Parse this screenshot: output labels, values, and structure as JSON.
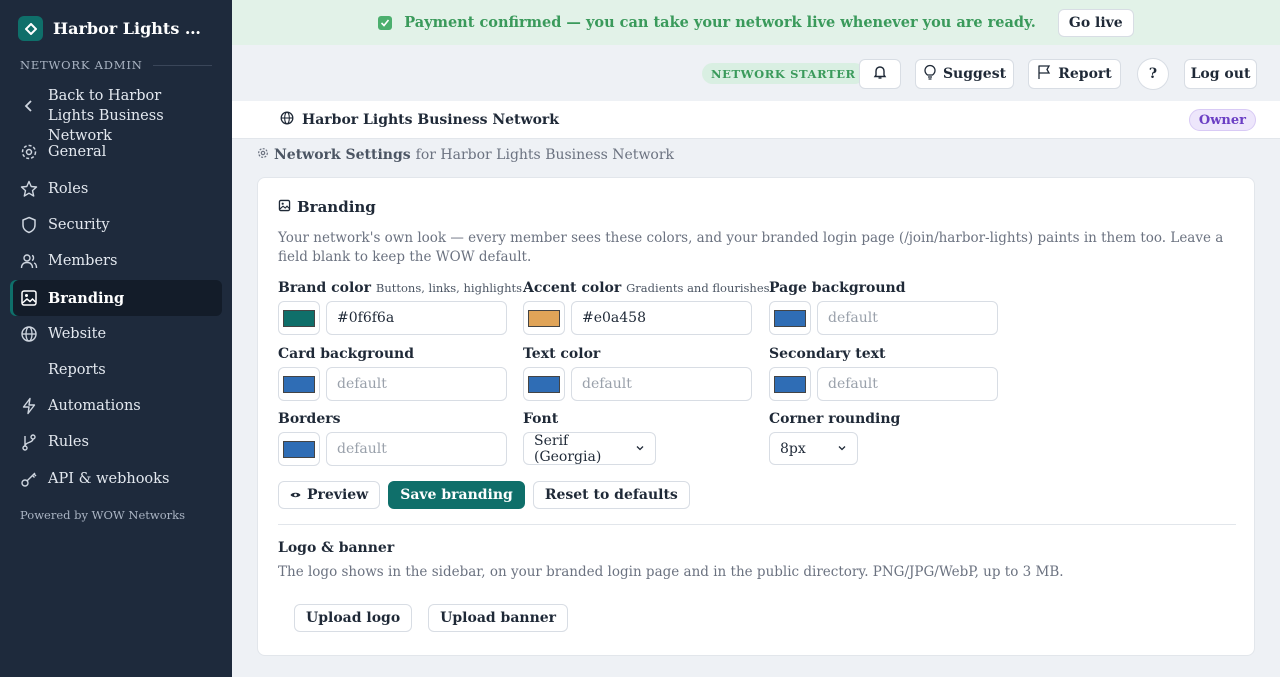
{
  "app": {
    "network_name": "Harbor Lights Business Network"
  },
  "sidebar": {
    "section_label": "NETWORK ADMIN",
    "back_label": "Back to Harbor Lights Business Network",
    "items": [
      {
        "label": "General",
        "icon": "gear-icon"
      },
      {
        "label": "Roles",
        "icon": "star-icon"
      },
      {
        "label": "Security",
        "icon": "shield-icon"
      },
      {
        "label": "Members",
        "icon": "users-icon"
      },
      {
        "label": "Branding",
        "icon": "image-icon",
        "active": true
      },
      {
        "label": "Website",
        "icon": "globe-icon"
      },
      {
        "label": "Reports",
        "icon": ""
      },
      {
        "label": "Automations",
        "icon": "bolt-icon"
      },
      {
        "label": "Rules",
        "icon": "branch-icon"
      },
      {
        "label": "API & webhooks",
        "icon": "key-icon"
      }
    ],
    "powered_by": "Powered by WOW Networks"
  },
  "banner": {
    "message": "Payment confirmed — you can take your network live whenever you are ready.",
    "go_live": "Go live"
  },
  "header": {
    "plan_badge": "NETWORK STARTER",
    "suggest": "Suggest",
    "report": "Report",
    "help": "?",
    "logout": "Log out"
  },
  "netbar": {
    "name": "Harbor Lights Business Network",
    "role_badge": "Owner"
  },
  "breadcrumb": {
    "title": "Network Settings",
    "suffix": "for Harbor Lights Business Network"
  },
  "branding": {
    "title": "Branding",
    "description": "Your network's own look — every member sees these colors, and your branded login page (/join/harbor-lights) paints in them too. Leave a field blank to keep the WOW default.",
    "fields": {
      "brand": {
        "label": "Brand color",
        "hint": "Buttons, links, highlights",
        "value": "#0f6f6a",
        "swatch": "#0f6f6a"
      },
      "accent": {
        "label": "Accent color",
        "hint": "Gradients and flourishes",
        "value": "#e0a458",
        "swatch": "#e0a458"
      },
      "page_bg": {
        "label": "Page background",
        "placeholder": "default",
        "swatch": "#2f6db5"
      },
      "card_bg": {
        "label": "Card background",
        "placeholder": "default",
        "swatch": "#2f6db5"
      },
      "text": {
        "label": "Text color",
        "placeholder": "default",
        "swatch": "#2f6db5"
      },
      "secondary": {
        "label": "Secondary text",
        "placeholder": "default",
        "swatch": "#2f6db5"
      },
      "borders": {
        "label": "Borders",
        "placeholder": "default",
        "swatch": "#2f6db5"
      },
      "font": {
        "label": "Font",
        "value": "Serif (Georgia)"
      },
      "corner": {
        "label": "Corner rounding",
        "value": "8px"
      }
    },
    "actions": {
      "preview": "Preview",
      "save": "Save branding",
      "reset": "Reset to defaults"
    },
    "logo": {
      "title": "Logo & banner",
      "description": "The logo shows in the sidebar, on your branded login page and in the public directory. PNG/JPG/WebP, up to 3 MB.",
      "upload_logo": "Upload logo",
      "upload_banner": "Upload banner"
    }
  },
  "colors": {
    "brand": "#0f6f6a",
    "sidebar": "#1e2a3c",
    "success": "#3a9a5b",
    "owner": "#6b3fc4"
  }
}
